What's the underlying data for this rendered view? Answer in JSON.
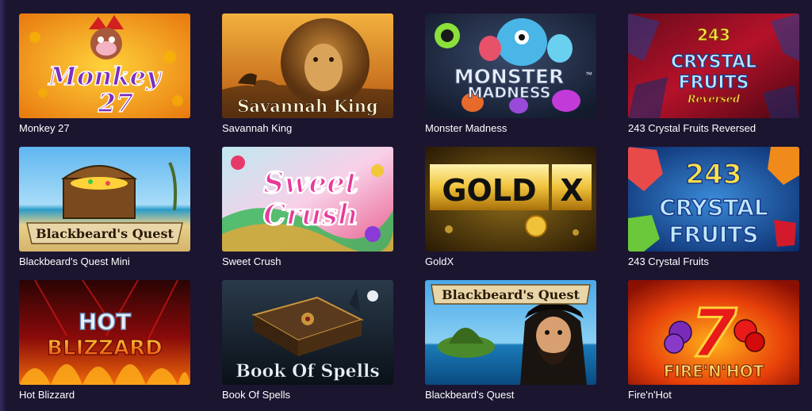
{
  "games": [
    {
      "title": "Monkey 27",
      "logo_lines": [
        "Monkey",
        "27"
      ]
    },
    {
      "title": "Savannah King",
      "logo_lines": [
        "Savannah King"
      ]
    },
    {
      "title": "Monster Madness",
      "logo_lines": [
        "MONSTER",
        "MADNESS"
      ],
      "mark": "™"
    },
    {
      "title": "243 Crystal Fruits Reversed",
      "logo_lines": [
        "243",
        "CRYSTAL",
        "FRUITS",
        "Reversed"
      ]
    },
    {
      "title": "Blackbeard's Quest Mini",
      "logo_lines": [
        "Blackbeard's Quest"
      ]
    },
    {
      "title": "Sweet Crush",
      "logo_lines": [
        "Sweet",
        "Crush"
      ]
    },
    {
      "title": "GoldX",
      "logo_lines": [
        "GOLD",
        "X"
      ]
    },
    {
      "title": "243 Crystal Fruits",
      "logo_lines": [
        "243",
        "CRYSTAL",
        "FRUITS"
      ]
    },
    {
      "title": "Hot Blizzard",
      "logo_lines": [
        "HOT",
        "BLIZZARD"
      ]
    },
    {
      "title": "Book Of Spells",
      "logo_lines": [
        "Book Of Spells"
      ]
    },
    {
      "title": "Blackbeard's Quest",
      "logo_lines": [
        "Blackbeard's Quest"
      ]
    },
    {
      "title": "Fire'n'Hot",
      "logo_lines": [
        "7",
        "FIRE'N'HOT"
      ]
    }
  ],
  "colors": {
    "background": "#1b1530",
    "title_text": "#ffffff"
  }
}
